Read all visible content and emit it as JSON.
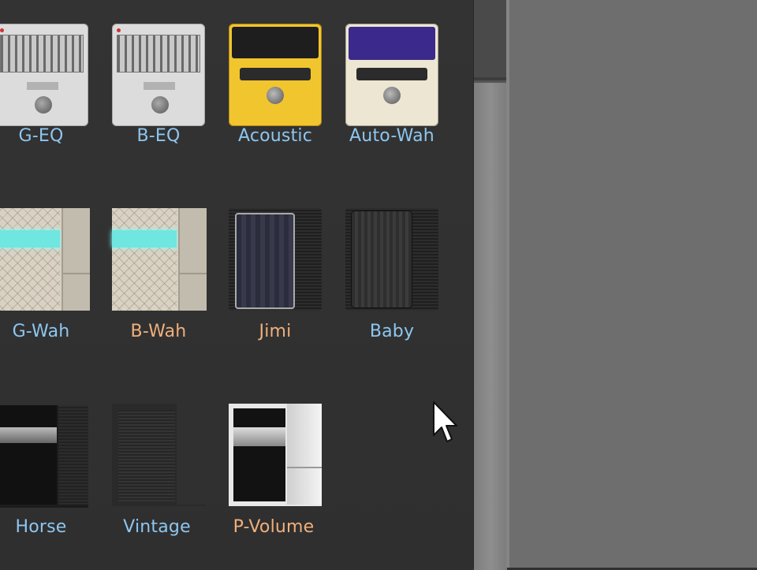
{
  "pedals": [
    {
      "label": "G-EQ",
      "color": "#8ec6f0"
    },
    {
      "label": "B-EQ",
      "color": "#8ec6f0"
    },
    {
      "label": "Acoustic",
      "color": "#8ec6f0"
    },
    {
      "label": "Auto-Wah",
      "color": "#8ec6f0"
    },
    {
      "label": "G-Wah",
      "color": "#8ec6f0"
    },
    {
      "label": "B-Wah",
      "color": "#efb07c"
    },
    {
      "label": "Jimi",
      "color": "#efb07c"
    },
    {
      "label": "Baby",
      "color": "#8ec6f0"
    },
    {
      "label": "Horse",
      "color": "#8ec6f0"
    },
    {
      "label": "Vintage",
      "color": "#8ec6f0"
    },
    {
      "label": "P-Volume",
      "color": "#efb07c"
    }
  ],
  "cursor_icon": "mouse-pointer-icon"
}
